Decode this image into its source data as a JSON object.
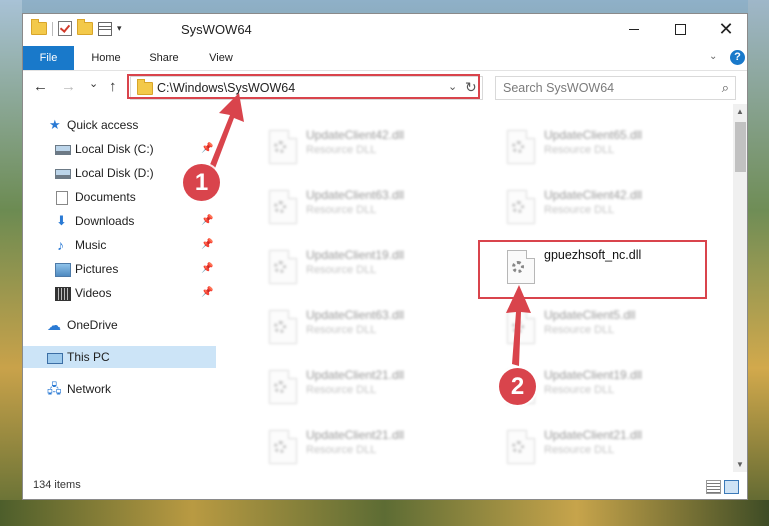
{
  "window": {
    "title": "SysWOW64"
  },
  "ribbon": {
    "tabs": [
      "File",
      "Home",
      "Share",
      "View"
    ],
    "help": "?"
  },
  "nav": {
    "back": "←",
    "forward": "→",
    "recent": "⌄",
    "up": "↑"
  },
  "address": {
    "path": "C:\\Windows\\SysWOW64"
  },
  "search": {
    "placeholder": "Search SysWOW64"
  },
  "sidebar": {
    "items": [
      {
        "label": "Quick access",
        "icon": "star-icon"
      },
      {
        "label": "Local Disk (C:)",
        "icon": "drive-icon",
        "pinned": true
      },
      {
        "label": "Local Disk (D:)",
        "icon": "drive-icon",
        "pinned": false
      },
      {
        "label": "Documents",
        "icon": "documents-icon",
        "pinned": true
      },
      {
        "label": "Downloads",
        "icon": "downloads-icon",
        "pinned": true
      },
      {
        "label": "Music",
        "icon": "music-icon",
        "pinned": true
      },
      {
        "label": "Pictures",
        "icon": "pictures-icon",
        "pinned": true
      },
      {
        "label": "Videos",
        "icon": "videos-icon",
        "pinned": true
      },
      {
        "label": "OneDrive",
        "icon": "onedrive-icon"
      },
      {
        "label": "This PC",
        "icon": "this-pc-icon",
        "selected": true
      },
      {
        "label": "Network",
        "icon": "network-icon"
      }
    ]
  },
  "files": [
    {
      "name": "UpdateClient42.dll",
      "type": "Resource DLL"
    },
    {
      "name": "UpdateClient65.dll",
      "type": "Resource DLL"
    },
    {
      "name": "UpdateClient63.dll",
      "type": "Resource DLL"
    },
    {
      "name": "UpdateClient42.dll",
      "type": "Resource DLL"
    },
    {
      "name": "UpdateClient19.dll",
      "type": "Resource DLL"
    },
    {
      "name": "gpuezhsoft_nc.dll",
      "type": ""
    },
    {
      "name": "UpdateClient63.dll",
      "type": "Resource DLL"
    },
    {
      "name": "UpdateClient5.dll",
      "type": "Resource DLL"
    },
    {
      "name": "UpdateClient21.dll",
      "type": "Resource DLL"
    },
    {
      "name": "UpdateClient19.dll",
      "type": "Resource DLL"
    },
    {
      "name": "UpdateClient21.dll",
      "type": "Resource DLL"
    },
    {
      "name": "UpdateClient21.dll",
      "type": "Resource DLL"
    }
  ],
  "status": {
    "item_count": "134 items"
  },
  "annotations": {
    "step1": "1",
    "step2": "2",
    "color": "#d9444c"
  }
}
